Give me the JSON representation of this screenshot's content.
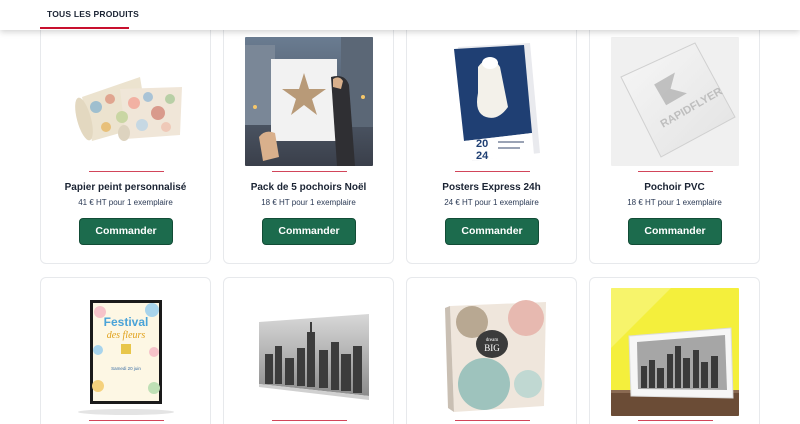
{
  "tabs": {
    "all_products": "TOUS LES PRODUITS"
  },
  "colors": {
    "accent": "#c8102e",
    "button": "#1c6b4d"
  },
  "products": [
    {
      "title": "Papier peint personnalisé",
      "price": "41 € HT pour 1 exemplaire",
      "cta": "Commander"
    },
    {
      "title": "Pack de 5 pochoirs Noël",
      "price": "18 € HT pour 1 exemplaire",
      "cta": "Commander"
    },
    {
      "title": "Posters Express 24h",
      "price": "24 € HT pour 1 exemplaire",
      "cta": "Commander"
    },
    {
      "title": "Pochoir PVC",
      "price": "18 € HT pour 1 exemplaire",
      "cta": "Commander"
    }
  ],
  "images": {
    "poster_year_top": "20",
    "poster_year_bottom": "24",
    "pochoir_brand": "RAPIDFLYER",
    "festival_line1": "Festival",
    "festival_line2": "des fleurs",
    "festival_date": "Samedi 20 juin",
    "book_brand": "dream",
    "book_brand2": "BIG"
  }
}
